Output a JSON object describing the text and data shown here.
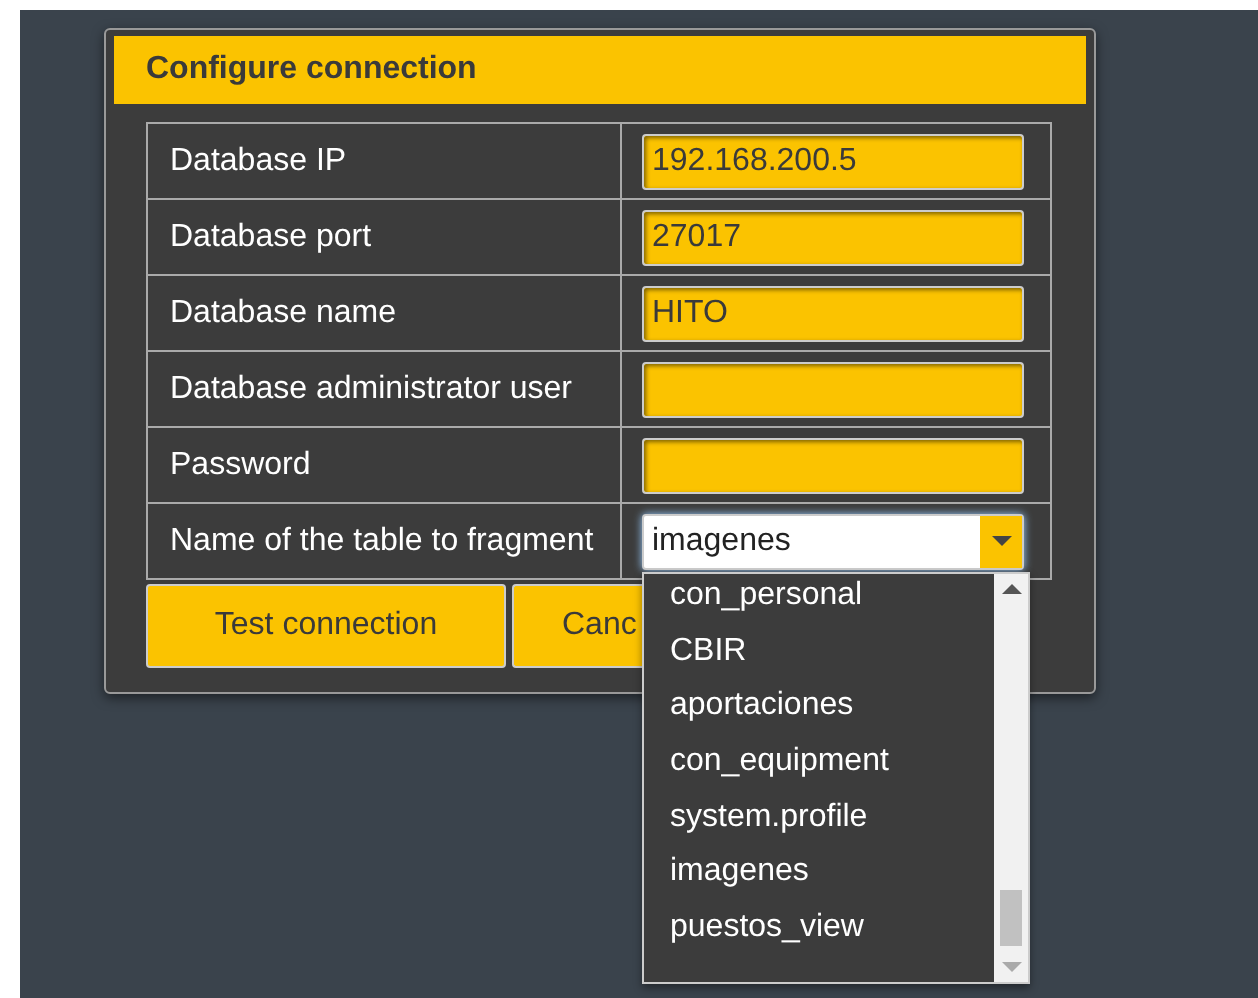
{
  "dialog": {
    "title": "Configure connection",
    "fields": [
      {
        "label": "Database IP",
        "kind": "text",
        "value": "192.168.200.5"
      },
      {
        "label": "Database port",
        "kind": "text",
        "value": "27017"
      },
      {
        "label": "Database name",
        "kind": "text",
        "value": "HITO"
      },
      {
        "label": "Database administrator user",
        "kind": "text"
      },
      {
        "label": "Password",
        "kind": "password"
      },
      {
        "label": "Name of the table to fragment",
        "kind": "select",
        "value": "imagenes",
        "expanded": true,
        "options": [
          "con_personal",
          "CBIR",
          "aportaciones",
          "con_equipment",
          "system.profile",
          "imagenes",
          "puestos_view"
        ]
      }
    ],
    "buttons": [
      "Test connection",
      "Canc"
    ]
  }
}
